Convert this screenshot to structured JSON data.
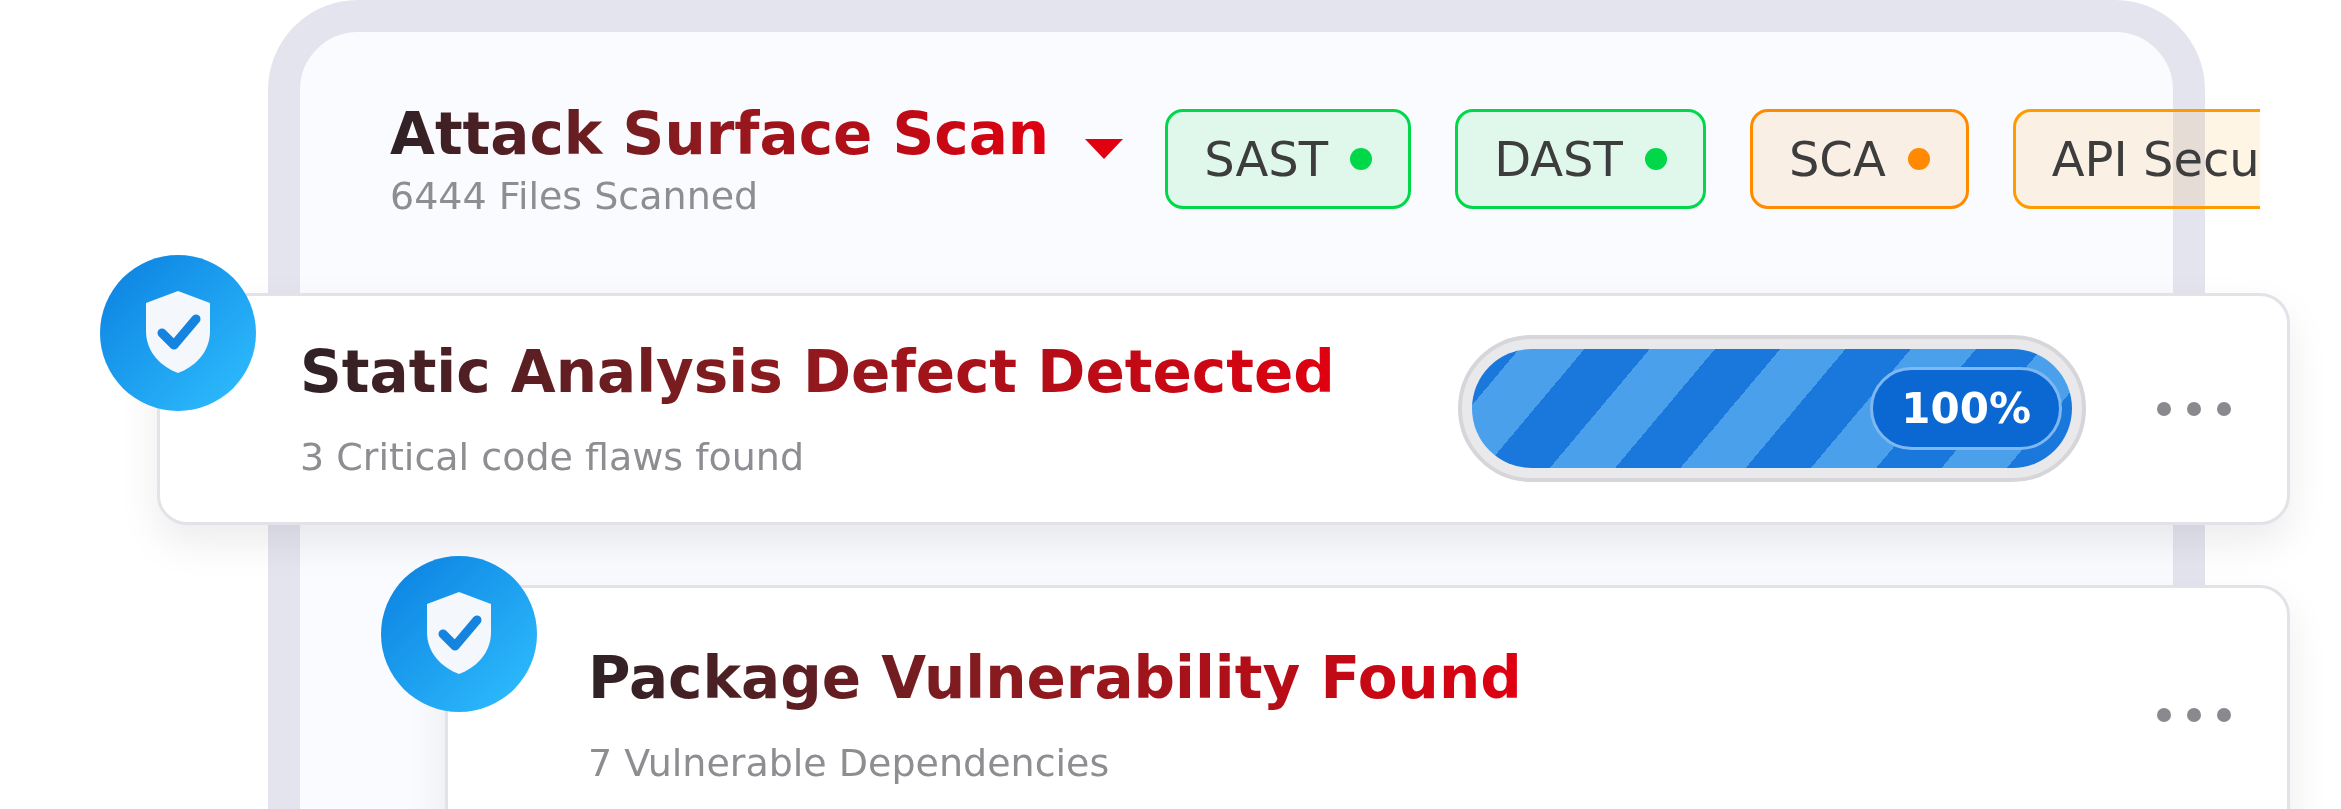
{
  "panel": {
    "title": "Attack Surface Scan",
    "subtitle": "6444 Files Scanned"
  },
  "tags": [
    {
      "label": "SAST",
      "color": "#00d84a",
      "kind": "full"
    },
    {
      "label": "DAST",
      "color": "#00d84a",
      "kind": "full"
    },
    {
      "label": "SCA",
      "color": "#ff8a00",
      "kind": "full"
    },
    {
      "label": "API Secu",
      "color": "#ff9a00",
      "kind": "partial"
    }
  ],
  "cards": [
    {
      "title": "Static Analysis Defect Detected",
      "subtitle": "3 Critical code flaws found",
      "progress": {
        "level": 1.0,
        "reading": "100%"
      }
    },
    {
      "title": "Package Vulnerability Found",
      "subtitle": "7 Vulnerable Dependencies"
    }
  ]
}
